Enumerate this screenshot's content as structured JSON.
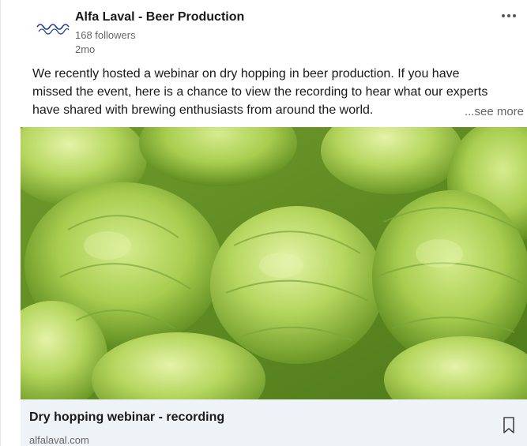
{
  "post": {
    "company_name": "Alfa Laval - Beer Production",
    "followers": "168 followers",
    "time_ago": "2mo",
    "text_lines": [
      "We recently hosted a webinar on dry hopping in beer production. If you have",
      "missed the event, here is a chance to view the recording to hear what our experts",
      "have shared with brewing enthusiasts from around the world."
    ],
    "see_more": "...see more"
  },
  "link_preview": {
    "title": "Dry hopping webinar - recording",
    "domain": "alfalaval.com"
  },
  "icons": {
    "menu": "more-horizontal-icon",
    "save": "bookmark-icon",
    "logo": "alfa-laval-logo"
  },
  "colors": {
    "brand_blue": "#1d3f8a",
    "link_bar_bg": "#eef3f8",
    "hop_green": "#9bc441"
  }
}
